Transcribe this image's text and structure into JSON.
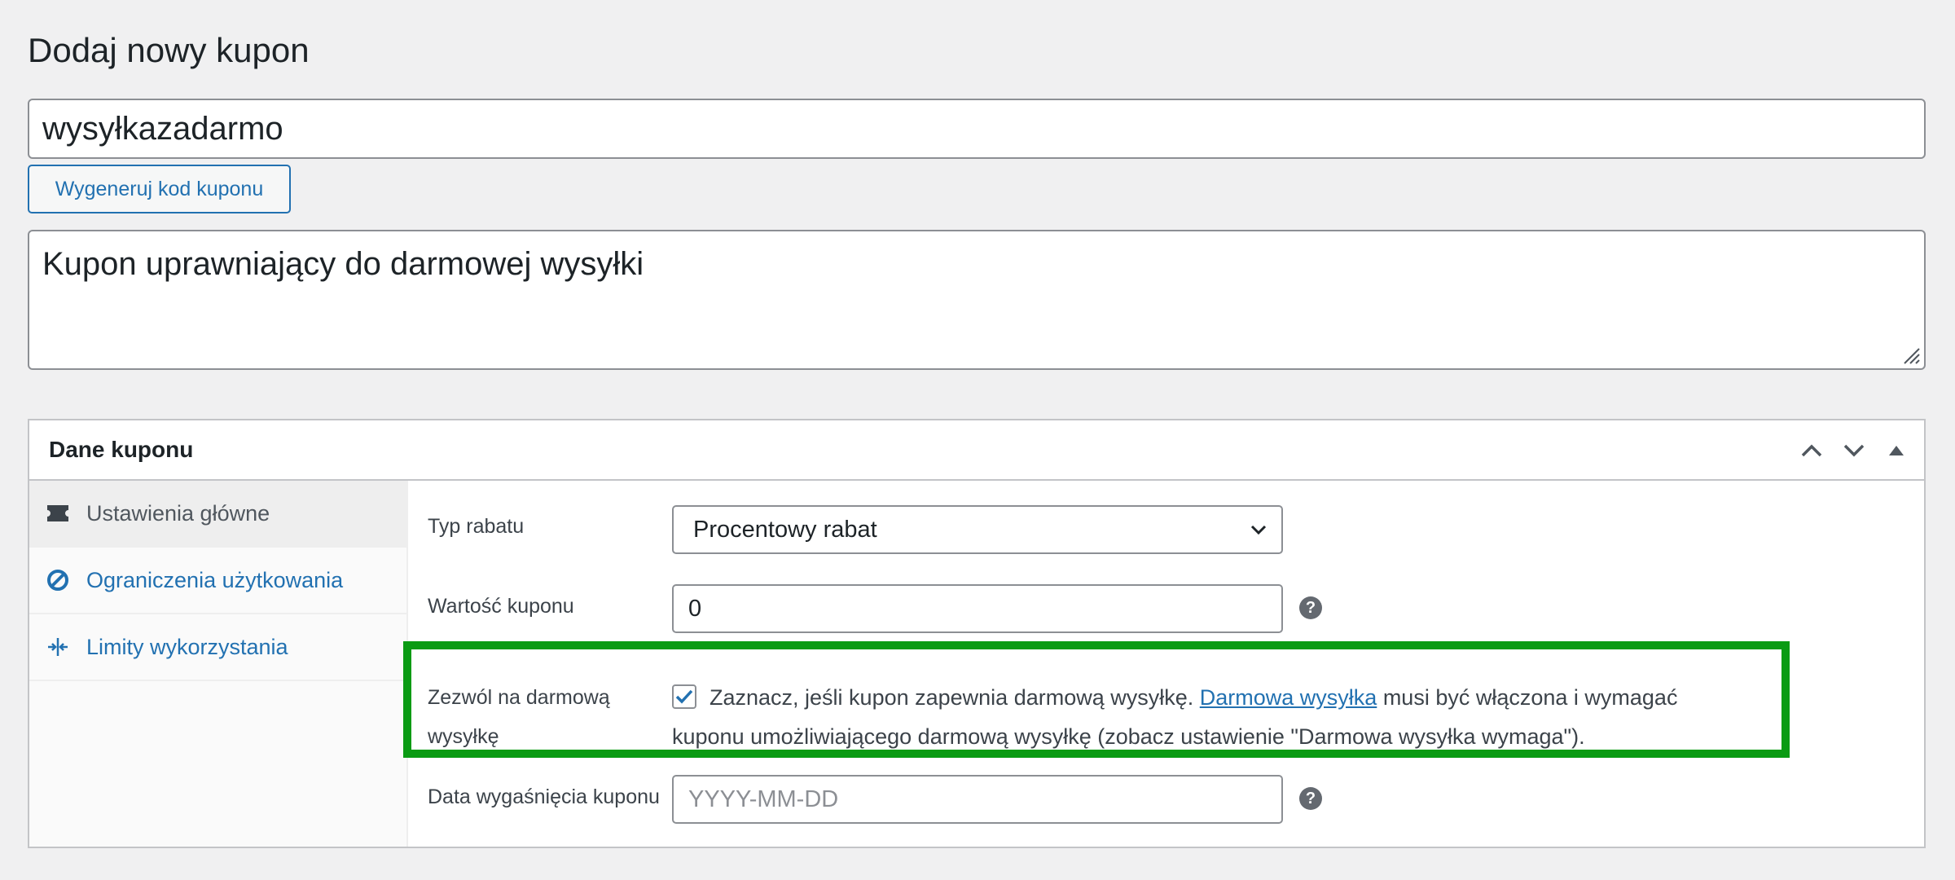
{
  "page": {
    "title": "Dodaj nowy kupon"
  },
  "coupon": {
    "code": "wysyłkazadarmo",
    "generate_label": "Wygeneruj kod kuponu",
    "description": "Kupon uprawniający do darmowej wysyłki"
  },
  "panel": {
    "title": "Dane kuponu",
    "tabs": [
      {
        "label": "Ustawienia główne",
        "icon": "ticket-icon",
        "active": true
      },
      {
        "label": "Ograniczenia użytkowania",
        "icon": "block-icon",
        "active": false
      },
      {
        "label": "Limity wykorzystania",
        "icon": "limits-icon",
        "active": false
      }
    ],
    "fields": {
      "discount_type_label": "Typ rabatu",
      "discount_type_value": "Procentowy rabat",
      "amount_label": "Wartość kuponu",
      "amount_value": "0",
      "free_shipping_label_line1": "Zezwól na darmową",
      "free_shipping_label_line2": "wysyłkę",
      "free_shipping_checked": true,
      "free_shipping_desc_before": "Zaznacz, jeśli kupon zapewnia darmową wysyłkę. ",
      "free_shipping_link": "Darmowa wysyłka",
      "free_shipping_desc_after": " musi być włączona i wymagać kuponu umożliwiającego darmową wysyłkę (zobacz ustawienie \"Darmowa wysyłka wymaga\").",
      "expiry_label": "Data wygaśnięcia kuponu",
      "expiry_placeholder": "YYYY-MM-DD",
      "help_glyph": "?"
    }
  },
  "colors": {
    "accent": "#2271b1",
    "highlight": "#0a9b13",
    "background": "#f0f0f1"
  }
}
